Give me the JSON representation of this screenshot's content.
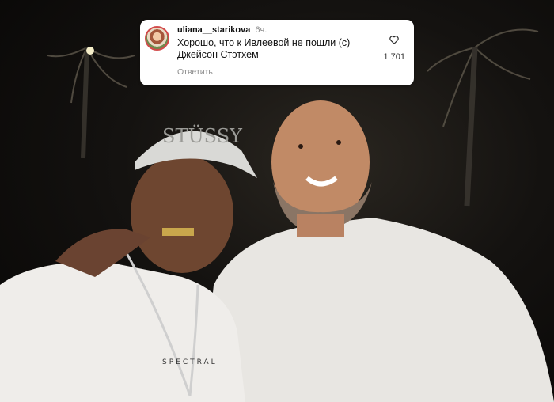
{
  "comment": {
    "username": "uliana__starikova",
    "time": "6ч.",
    "text": "Хорошо, что к Ивлеевой не пошли (с) Джейсон Стэтхем",
    "reply_label": "Ответить",
    "like_count": "1 701",
    "like_icon": "heart-outline-icon"
  },
  "photo": {
    "cap_text": "STÜSSY",
    "shirt_text": "SPECTRAL"
  },
  "colors": {
    "card_bg": "#ffffff",
    "muted_text": "#8e8e8e",
    "avatar_ring": "#d24b4b"
  }
}
